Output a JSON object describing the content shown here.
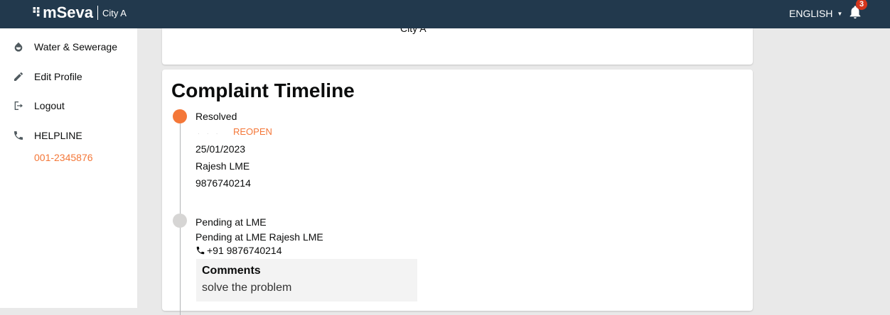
{
  "header": {
    "logo_mark": "⠻",
    "logo_text": "mSeva",
    "city": "City A",
    "language": "ENGLISH",
    "notification_count": "3"
  },
  "sidebar": {
    "items": [
      {
        "label": "Water & Sewerage",
        "icon": "water-drop-icon"
      },
      {
        "label": "Edit Profile",
        "icon": "pencil-icon"
      },
      {
        "label": "Logout",
        "icon": "logout-icon"
      },
      {
        "label": "HELPLINE",
        "icon": "phone-icon"
      }
    ],
    "helpline_number": "001-2345876"
  },
  "top_card": {
    "cut_text": "City A"
  },
  "timeline": {
    "title": "Complaint Timeline",
    "steps": [
      {
        "status": "Resolved",
        "action": "REOPEN",
        "date": "25/01/2023",
        "name": "Rajesh LME",
        "phone": "9876740214"
      },
      {
        "status": "Pending at LME",
        "detail": "Pending at LME Rajesh LME",
        "phone": "+91 9876740214",
        "comments_label": "Comments",
        "comments_text": "solve the problem"
      }
    ]
  },
  "colors": {
    "topbar": "#22394d",
    "accent": "#f47738",
    "badge": "#d4351c",
    "pending_dot": "#d6d5d4"
  }
}
